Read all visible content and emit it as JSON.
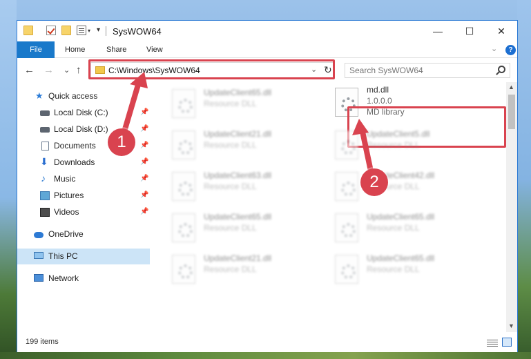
{
  "window": {
    "title": "SysWOW64",
    "minimize_glyph": "—",
    "maximize_glyph": "☐",
    "close_glyph": "✕"
  },
  "ribbon": {
    "tabs": [
      "File",
      "Home",
      "Share",
      "View"
    ],
    "collapse_glyph": "⌄",
    "help_glyph": "?"
  },
  "nav": {
    "back_glyph": "←",
    "forward_glyph": "→",
    "recent_glyph": "⌄",
    "up_glyph": "↑",
    "address": "C:\\Windows\\SysWOW64",
    "address_dropdown_glyph": "⌄",
    "refresh_glyph": "↻",
    "search_placeholder": "Search SysWOW64"
  },
  "sidebar": {
    "items": [
      {
        "label": "Quick access",
        "icon": "star-icon"
      },
      {
        "label": "Local Disk (C:)",
        "icon": "disk-icon",
        "pinned": true
      },
      {
        "label": "Local Disk (D:)",
        "icon": "disk-icon",
        "pinned": true
      },
      {
        "label": "Documents",
        "icon": "documents-icon",
        "pinned": true
      },
      {
        "label": "Downloads",
        "icon": "download-icon",
        "pinned": true
      },
      {
        "label": "Music",
        "icon": "music-icon",
        "pinned": true
      },
      {
        "label": "Pictures",
        "icon": "pictures-icon",
        "pinned": true
      },
      {
        "label": "Videos",
        "icon": "videos-icon",
        "pinned": true
      },
      {
        "label": "OneDrive",
        "icon": "cloud-icon"
      },
      {
        "label": "This PC",
        "icon": "computer-icon",
        "selected": true
      },
      {
        "label": "Network",
        "icon": "network-icon"
      }
    ],
    "pin_glyph": "📌"
  },
  "files": {
    "highlighted": {
      "name": "md.dll",
      "version": "1.0.0.0",
      "description": "MD library"
    },
    "left_column": [
      {
        "name": "UpdateClient65.dll",
        "description": "Resource DLL"
      },
      {
        "name": "UpdateClient21.dll",
        "description": "Resource DLL"
      },
      {
        "name": "UpdateClient63.dll",
        "description": "Resource DLL"
      },
      {
        "name": "UpdateClient65.dll",
        "description": "Resource DLL"
      },
      {
        "name": "UpdateClient21.dll",
        "description": "Resource DLL"
      }
    ],
    "right_column": [
      {
        "name": "UpdateClient5.dll",
        "description": "Resource DLL"
      },
      {
        "name": "UpdateClient42.dll",
        "description": "Resource DLL"
      },
      {
        "name": "UpdateClient65.dll",
        "description": "Resource DLL"
      },
      {
        "name": "UpdateClient65.dll",
        "description": "Resource DLL"
      }
    ]
  },
  "status": {
    "item_count": "199 items"
  },
  "annotations": {
    "step1": "1",
    "step2": "2",
    "color": "#d9434f"
  }
}
